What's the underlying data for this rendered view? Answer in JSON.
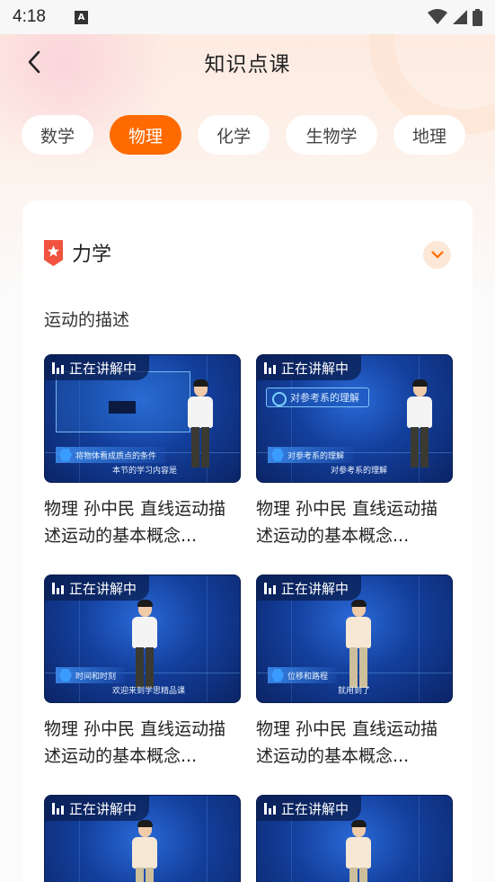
{
  "status_bar": {
    "time": "4:18"
  },
  "header": {
    "title": "知识点课"
  },
  "tabs": [
    {
      "label": "数学",
      "active": false
    },
    {
      "label": "物理",
      "active": true
    },
    {
      "label": "化学",
      "active": false
    },
    {
      "label": "生物学",
      "active": false
    },
    {
      "label": "地理",
      "active": false
    }
  ],
  "section": {
    "title": "力学",
    "subtitle": "运动的描述",
    "videos": [
      {
        "badge": "正在讲解中",
        "title": "物理 孙中民 直线运动描述运动的基本概念...",
        "slide_caption": "将物体看成质点的条件",
        "subtitle_text": "本节的学习内容是"
      },
      {
        "badge": "正在讲解中",
        "title": "物理 孙中民 直线运动描述运动的基本概念...",
        "slide_heading": "对参考系的理解",
        "slide_caption": "对参考系的理解",
        "subtitle_text": "对参考系的理解"
      },
      {
        "badge": "正在讲解中",
        "title": "物理 孙中民 直线运动描述运动的基本概念...",
        "slide_caption": "时间和时刻",
        "subtitle_text": "欢迎来到学思精品课"
      },
      {
        "badge": "正在讲解中",
        "title": "物理 孙中民 直线运动描述运动的基本概念...",
        "slide_caption": "位移和路程",
        "subtitle_text": "就用到了"
      },
      {
        "badge": "正在讲解中",
        "title": "",
        "slide_caption": "",
        "subtitle_text": ""
      },
      {
        "badge": "正在讲解中",
        "title": "",
        "slide_caption": "",
        "subtitle_text": ""
      }
    ]
  },
  "colors": {
    "accent": "#fe6a00",
    "accent_light": "#fde7d6",
    "card_bg": "#ffffff"
  }
}
